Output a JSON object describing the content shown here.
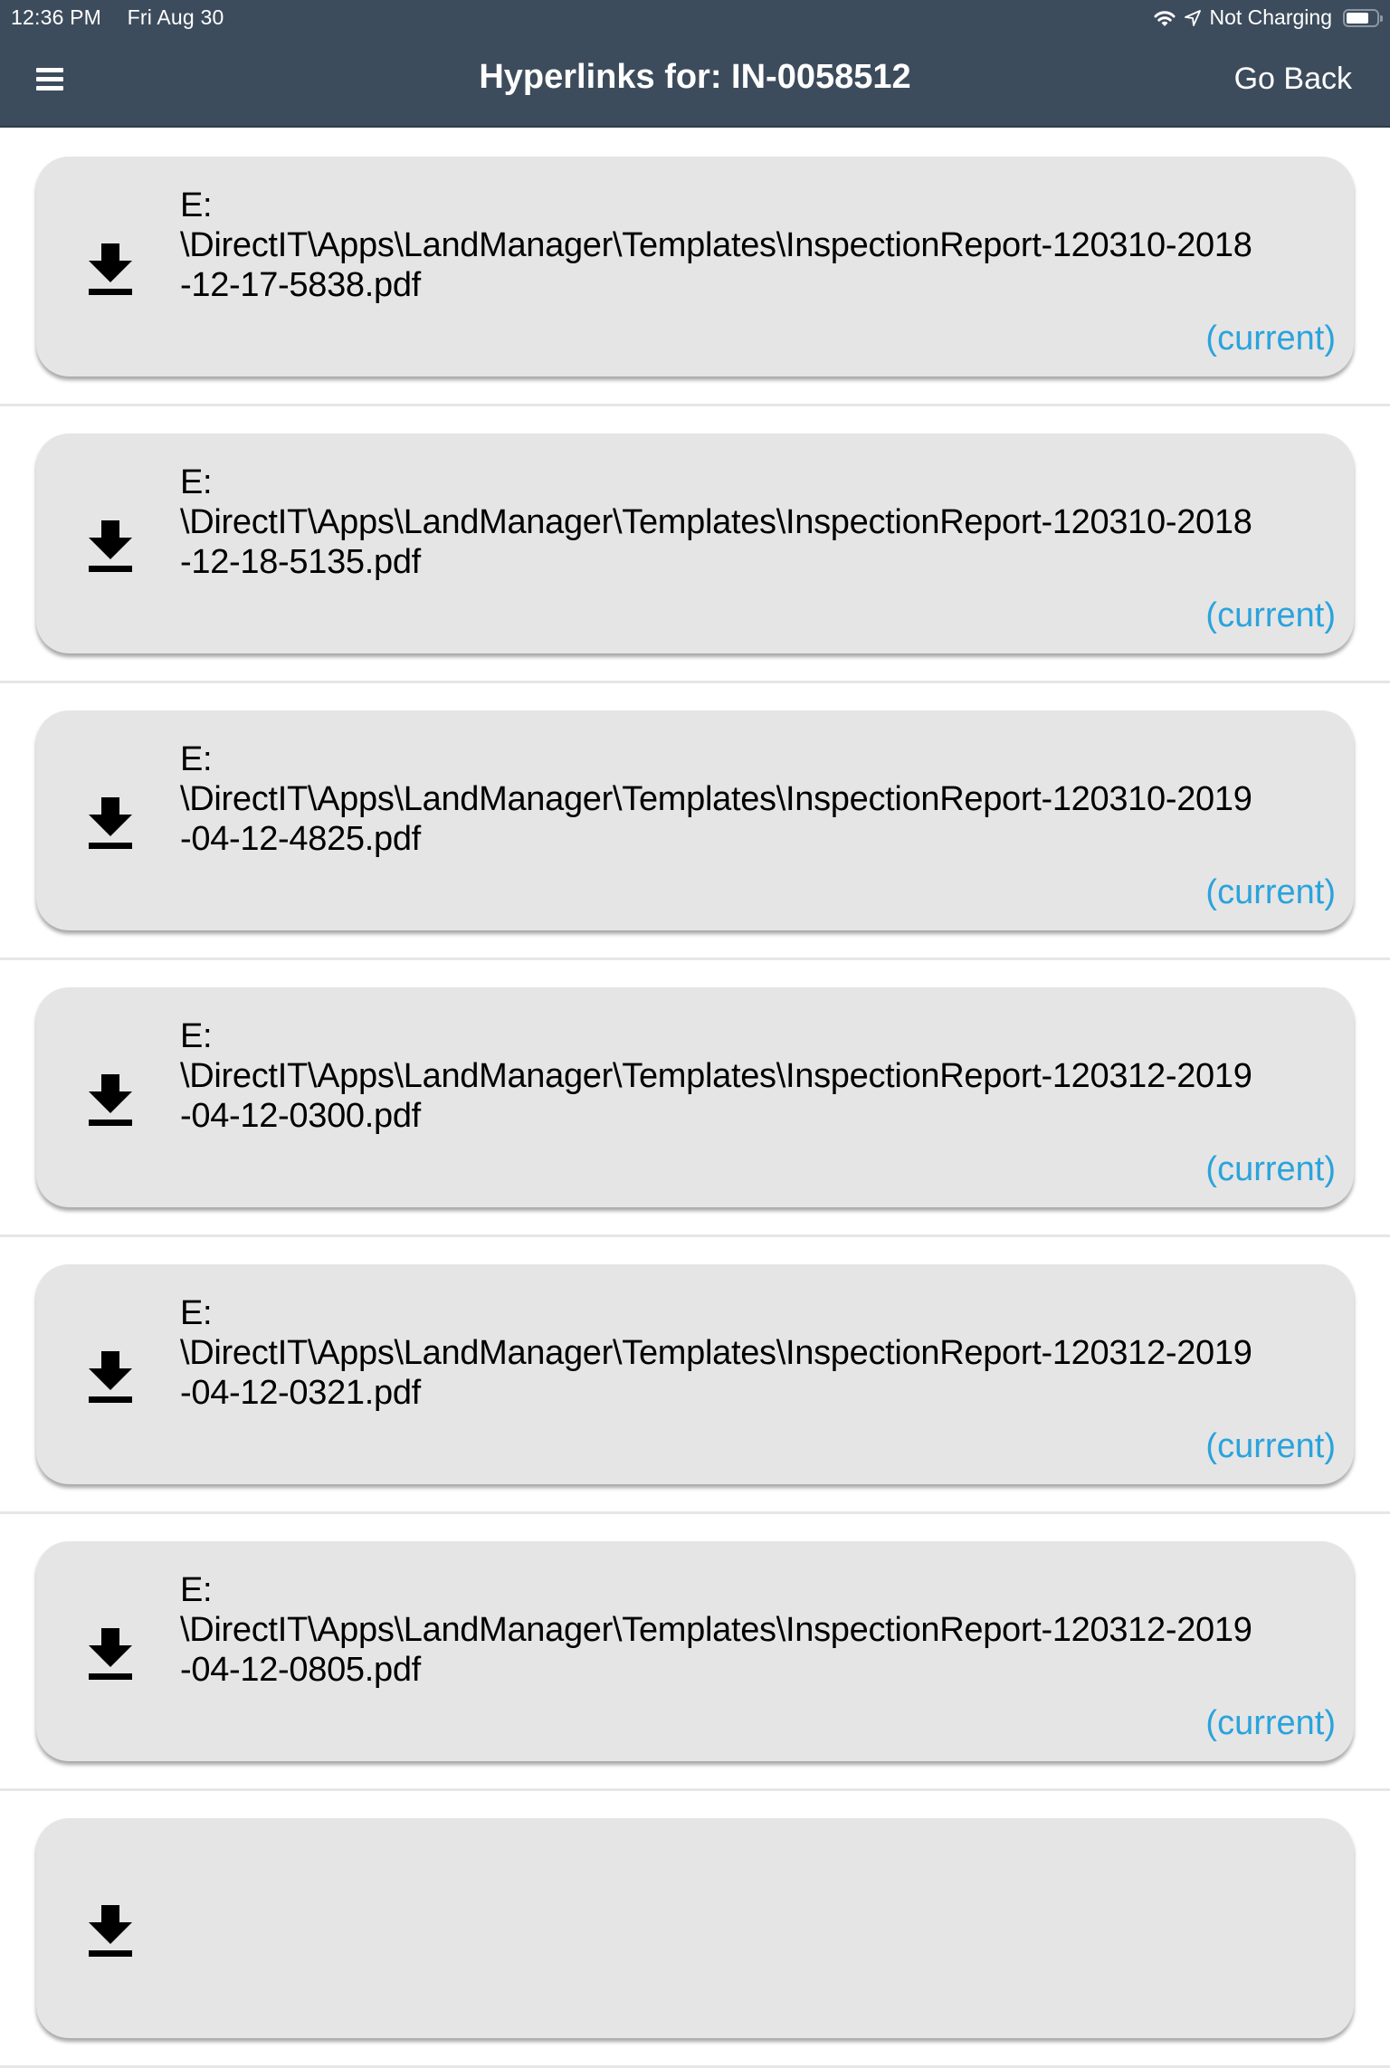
{
  "status_bar": {
    "time": "12:36 PM",
    "date": "Fri Aug 30",
    "wifi_icon": "wifi-icon",
    "location_icon": "location-arrow-icon",
    "battery_text": "Not Charging",
    "battery_icon": "battery-icon",
    "battery_level_percent": 75
  },
  "header": {
    "menu_icon": "hamburger-menu-icon",
    "title": "Hyperlinks for: IN-0058512",
    "back_label": "Go Back",
    "background_color": "#3d4c5c"
  },
  "colors": {
    "card_background": "#e5e5e5",
    "current_tag": "#2aa3dc"
  },
  "hyperlinks": [
    {
      "icon": "download-icon",
      "line1": "E:",
      "line2": "\\DirectIT\\Apps\\LandManager\\Templates\\InspectionReport-120310-2018",
      "line3": "-12-17-5838.pdf",
      "tag": "(current)"
    },
    {
      "icon": "download-icon",
      "line1": "E:",
      "line2": "\\DirectIT\\Apps\\LandManager\\Templates\\InspectionReport-120310-2018",
      "line3": "-12-18-5135.pdf",
      "tag": "(current)"
    },
    {
      "icon": "download-icon",
      "line1": "E:",
      "line2": "\\DirectIT\\Apps\\LandManager\\Templates\\InspectionReport-120310-2019",
      "line3": "-04-12-4825.pdf",
      "tag": "(current)"
    },
    {
      "icon": "download-icon",
      "line1": "E:",
      "line2": "\\DirectIT\\Apps\\LandManager\\Templates\\InspectionReport-120312-2019",
      "line3": "-04-12-0300.pdf",
      "tag": "(current)"
    },
    {
      "icon": "download-icon",
      "line1": "E:",
      "line2": "\\DirectIT\\Apps\\LandManager\\Templates\\InspectionReport-120312-2019",
      "line3": "-04-12-0321.pdf",
      "tag": "(current)"
    },
    {
      "icon": "download-icon",
      "line1": "E:",
      "line2": "\\DirectIT\\Apps\\LandManager\\Templates\\InspectionReport-120312-2019",
      "line3": "-04-12-0805.pdf",
      "tag": "(current)"
    },
    {
      "icon": "download-icon",
      "line1": "",
      "line2": "",
      "line3": "",
      "tag": ""
    }
  ]
}
